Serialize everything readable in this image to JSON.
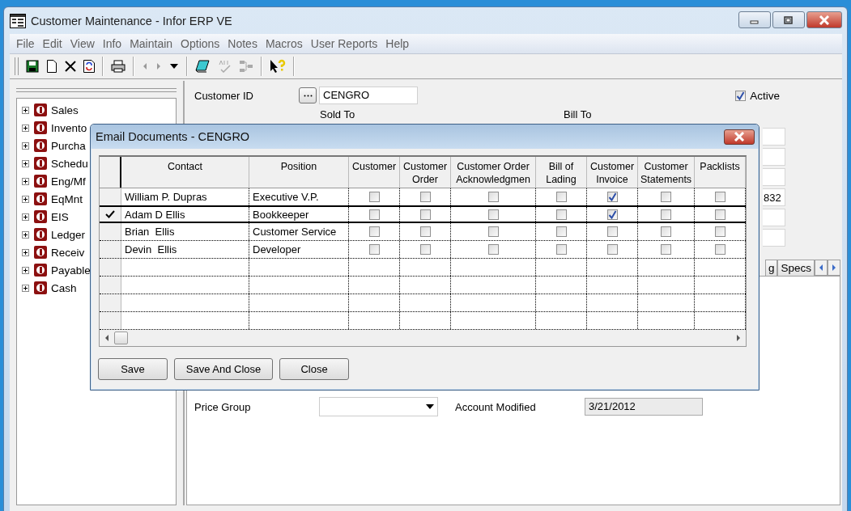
{
  "window": {
    "title": "Customer Maintenance - Infor ERP VE"
  },
  "menu": [
    "File",
    "Edit",
    "View",
    "Info",
    "Maintain",
    "Options",
    "Notes",
    "Macros",
    "User Reports",
    "Help"
  ],
  "nav_tree": [
    {
      "label": "Sales",
      "expanded": false
    },
    {
      "label": "Invento",
      "expanded": false
    },
    {
      "label": "Purcha",
      "expanded": false
    },
    {
      "label": "Schedu",
      "expanded": false
    },
    {
      "label": "Eng/Mf",
      "expanded": false
    },
    {
      "label": "EqMnt",
      "expanded": false
    },
    {
      "label": "EIS",
      "expanded": false
    },
    {
      "label": "Ledger",
      "expanded": false
    },
    {
      "label": "Receiv",
      "expanded": false
    },
    {
      "label": "Payable",
      "expanded": false
    },
    {
      "label": "Cash",
      "expanded": false
    }
  ],
  "customer_form": {
    "customer_id_label": "Customer ID",
    "customer_id": "CENGRO",
    "sold_to_label": "Sold To",
    "bill_to_label": "Bill To",
    "active": {
      "label": "Active",
      "checked": true
    },
    "field_fragment": "832",
    "tabs": [
      {
        "label": "g",
        "selected": false
      },
      {
        "label": "Specs",
        "selected": false
      }
    ],
    "price_group_label": "Price Group",
    "account_modified_label": "Account Modified",
    "account_modified": "3/21/2012"
  },
  "dialog": {
    "title": "Email Documents - CENGRO",
    "columns": [
      "Contact",
      "Position",
      "Customer",
      "Customer Order",
      "Customer Order Acknowledgmen",
      "Bill of Lading",
      "Customer Invoice",
      "Customer Statements",
      "Packlists"
    ],
    "rows": [
      {
        "contact": "William P. Dupras",
        "position": "Executive V.P.",
        "selected": false,
        "documents": [
          false,
          false,
          false,
          false,
          true,
          false,
          false
        ]
      },
      {
        "contact": "Adam D Ellis",
        "position": "Bookkeeper",
        "selected": true,
        "documents": [
          false,
          false,
          false,
          false,
          true,
          false,
          false
        ]
      },
      {
        "contact": "Brian  Ellis",
        "position": "Customer Service",
        "selected": false,
        "documents": [
          false,
          false,
          false,
          false,
          false,
          false,
          false
        ]
      },
      {
        "contact": "Devin  Ellis",
        "position": "Developer",
        "selected": false,
        "documents": [
          false,
          false,
          false,
          false,
          false,
          false,
          false
        ]
      }
    ],
    "buttons": [
      "Save",
      "Save And Close",
      "Close"
    ]
  }
}
